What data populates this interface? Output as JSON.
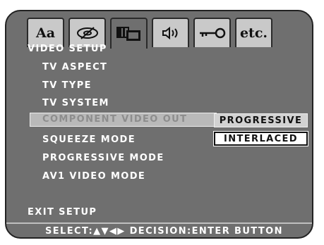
{
  "tabs": [
    {
      "icon": "language-icon",
      "glyph": "Aa",
      "active": false
    },
    {
      "icon": "disc-icon",
      "glyph": "",
      "active": false
    },
    {
      "icon": "video-display-icon",
      "glyph": "",
      "active": true
    },
    {
      "icon": "speaker-icon",
      "glyph": "",
      "active": false
    },
    {
      "icon": "key-icon",
      "glyph": "",
      "active": false
    },
    {
      "icon": "etc-icon",
      "glyph": "etc.",
      "active": false
    }
  ],
  "menu": {
    "title": "VIDEO SETUP",
    "items": [
      "TV ASPECT",
      "TV TYPE",
      "TV SYSTEM",
      "COMPONENT VIDEO OUT",
      "SQUEEZE MODE",
      "PROGRESSIVE MODE",
      "AV1 VIDEO MODE"
    ],
    "exit": "EXIT SETUP"
  },
  "options": {
    "selected": "PROGRESSIVE",
    "other": "INTERLACED"
  },
  "footer": {
    "hint": "SELECT:▲▼◀▶ DECISION:ENTER BUTTON"
  },
  "colors": {
    "background": "#6f6f6f",
    "tab": "#c9c9c9",
    "text": "#ffffff",
    "highlight": "#b9b9b9"
  }
}
